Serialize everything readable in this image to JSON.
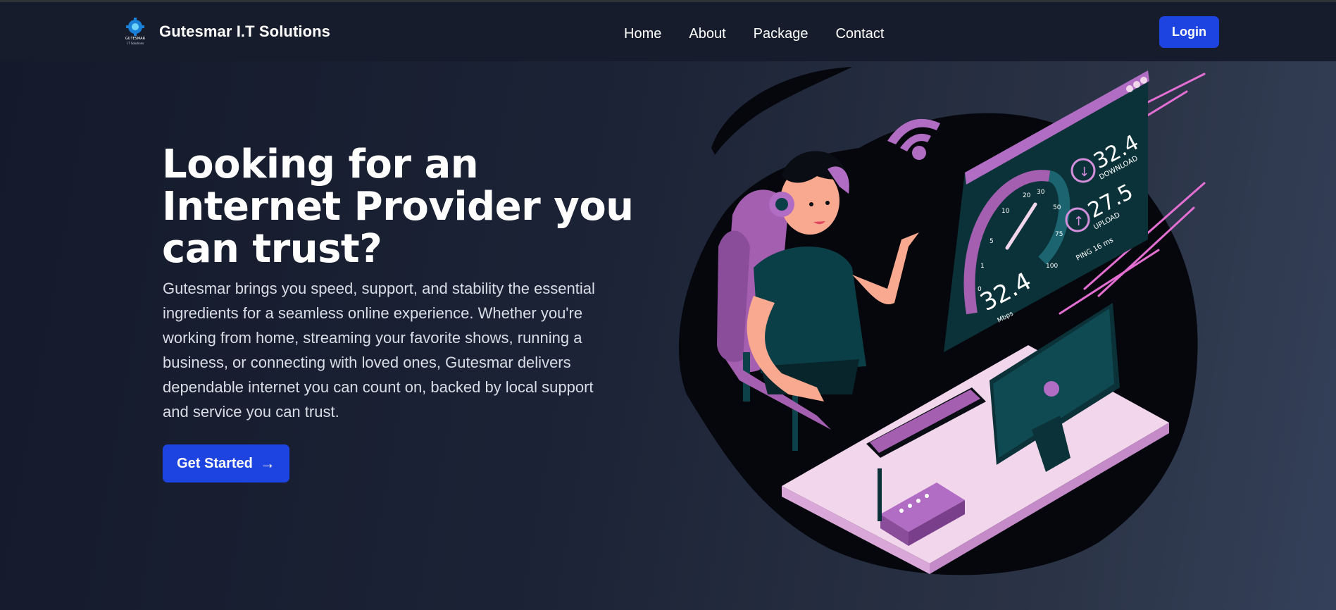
{
  "brand": {
    "logo_text": "GUTESMAR",
    "logo_subtext": "I.T Solutions",
    "name": "Gutesmar I.T Solutions"
  },
  "nav": {
    "links": [
      "Home",
      "About",
      "Package",
      "Contact"
    ],
    "login_label": "Login"
  },
  "hero": {
    "title": "Looking for an Internet Provider you can trust?",
    "description": "Gutesmar brings you speed, support, and stability the essential ingredients for a seamless online experience. Whether you're working from home, streaming your favorite shows, running a business, or connecting with loved ones, Gutesmar delivers dependable internet you can count on, backed by local support and service you can trust.",
    "cta_label": "Get Started",
    "cta_icon": "arrow-right-icon"
  },
  "illustration": {
    "download_value": "32.4",
    "download_label": "DOWNLOAD",
    "upload_value": "27.5",
    "upload_label": "UPLOAD",
    "ping_label": "PING 16 ms",
    "gauge_value": "32.4",
    "gauge_unit": "Mbps",
    "gauge_ticks": [
      "0",
      "1",
      "5",
      "10",
      "20",
      "30",
      "50",
      "75",
      "100"
    ]
  },
  "colors": {
    "accent": "#1d44e0",
    "nav_bg": "#161c2b",
    "purple": "#a45fb0",
    "pink": "#f2d6ec",
    "teal": "#0f4a52"
  }
}
